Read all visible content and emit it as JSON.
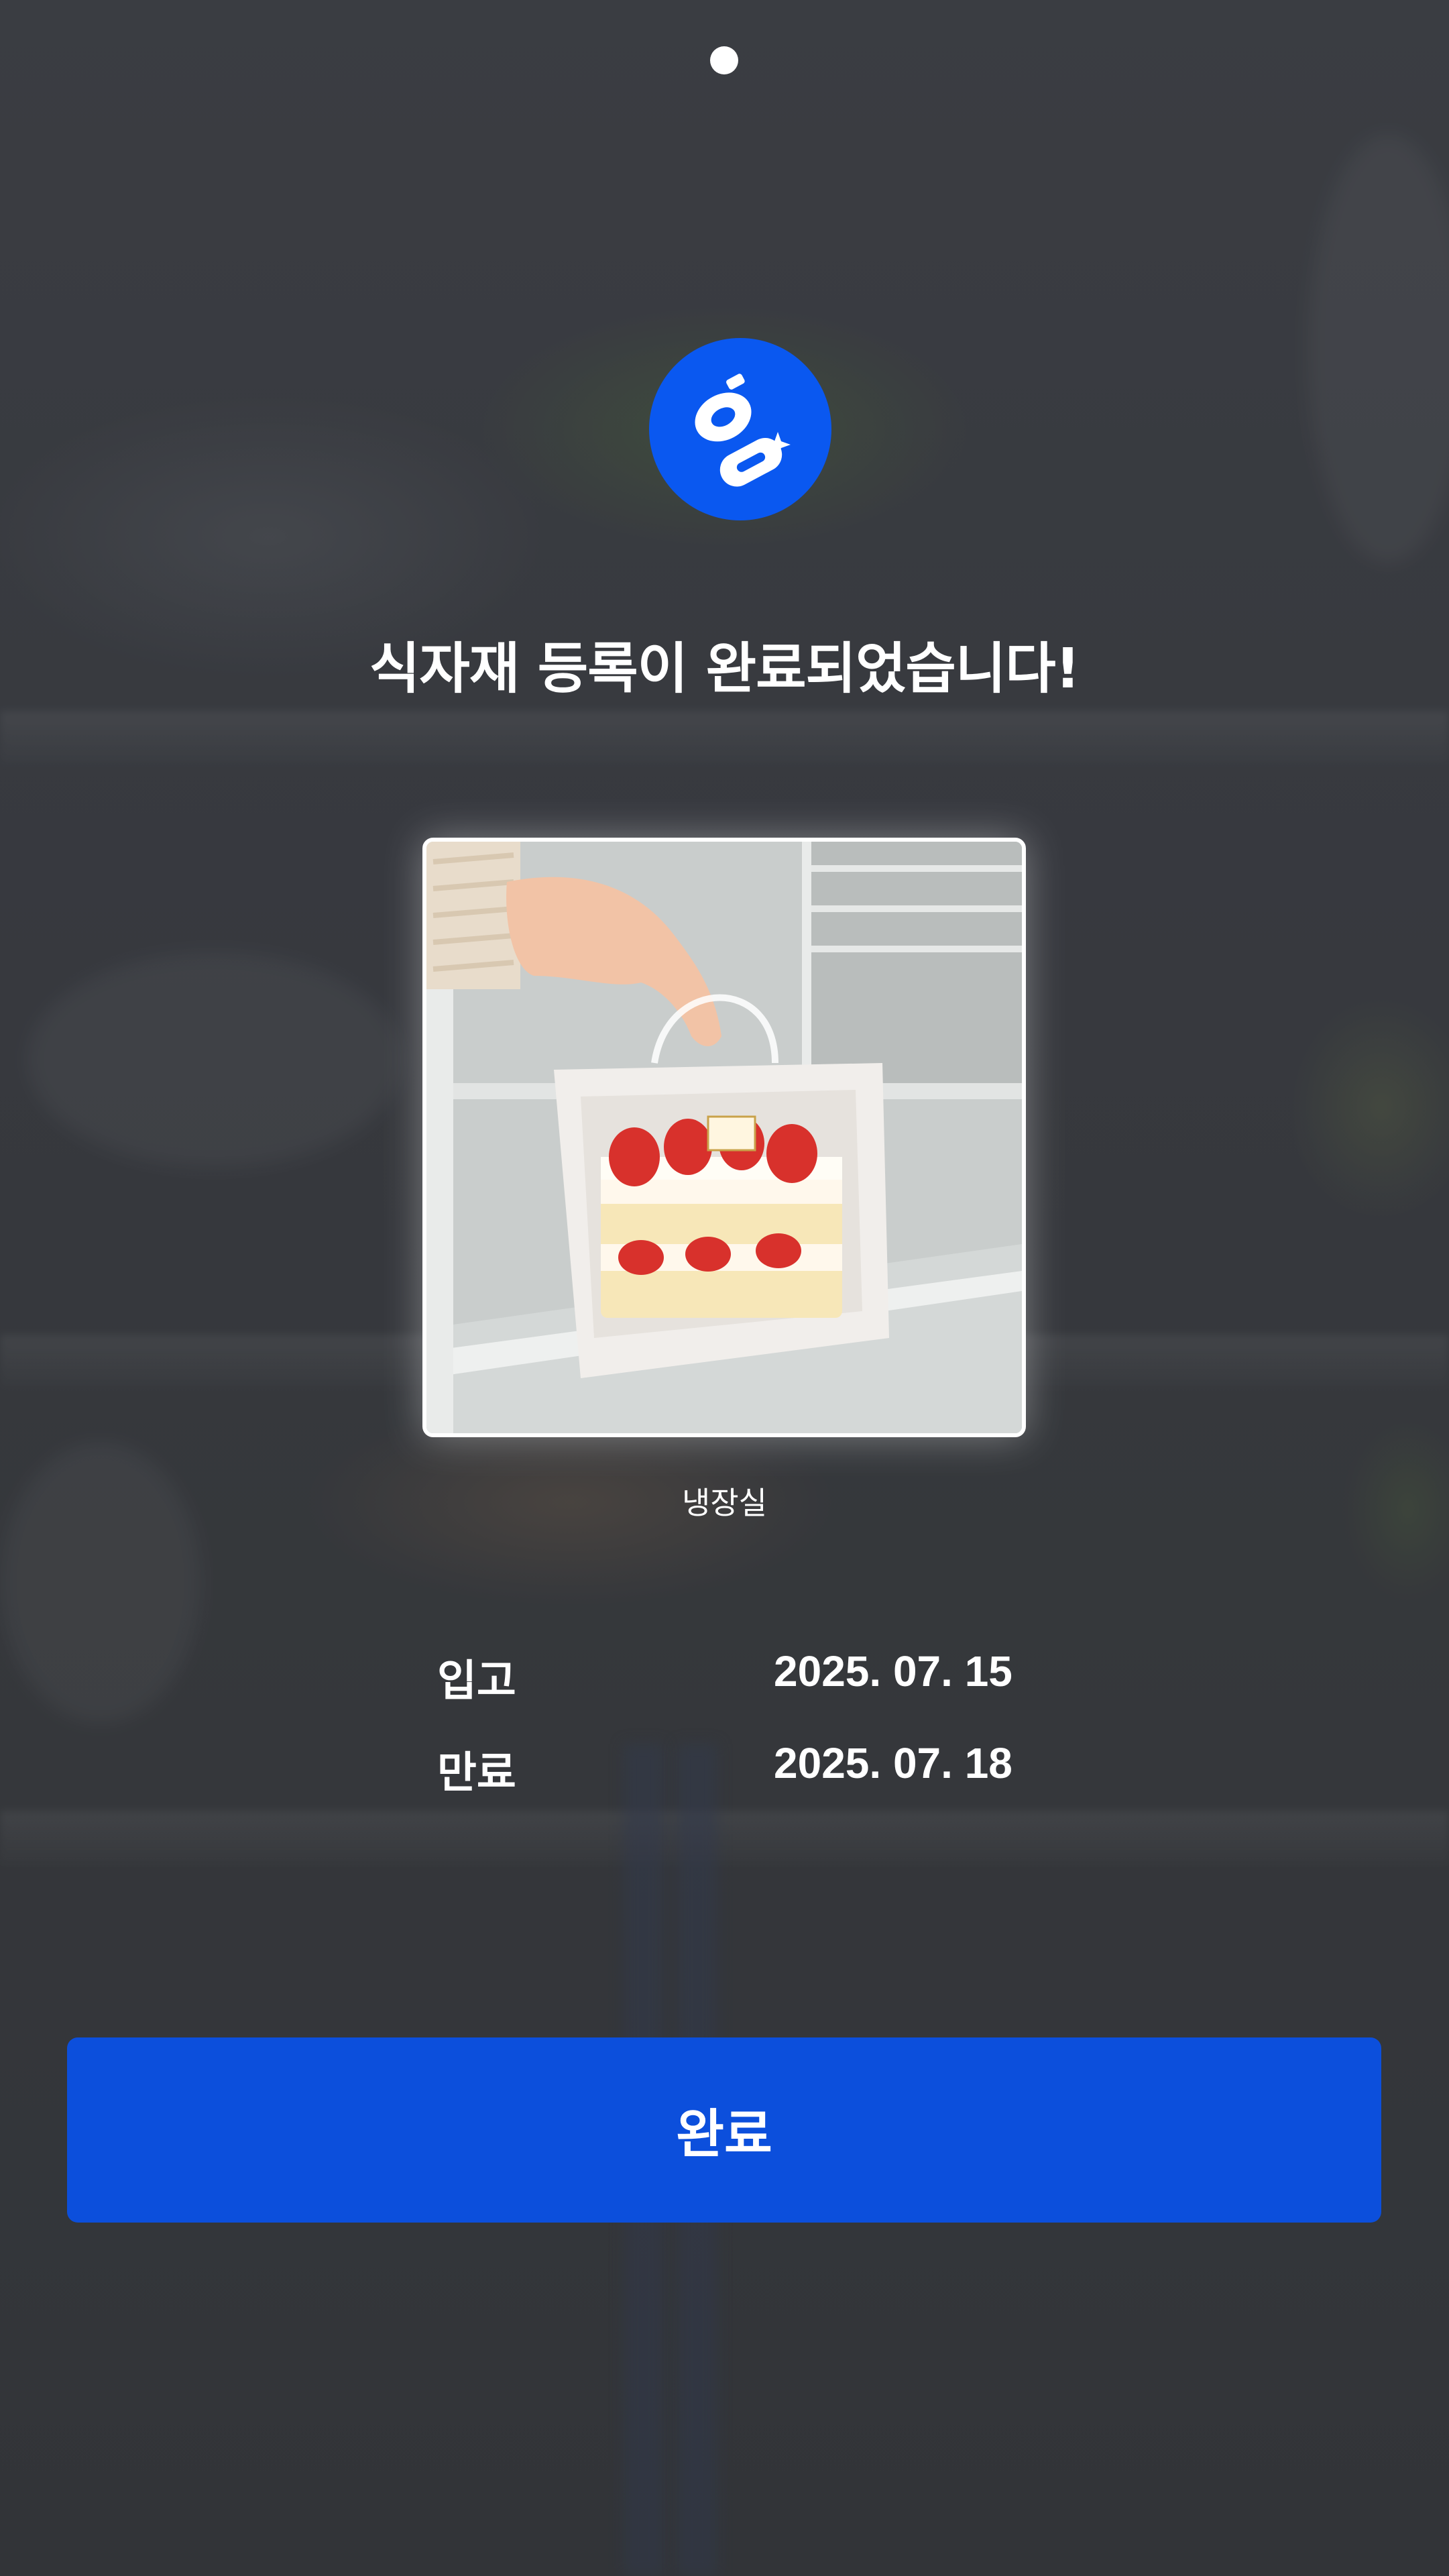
{
  "header": {
    "page_indicator_count": 1,
    "logo_icon": "app-logo-icon"
  },
  "main": {
    "title": "식자재 등록이 완료되었습니다!",
    "photo": {
      "icon": "food-photo-cake",
      "location": "냉장실"
    },
    "dates": [
      {
        "label": "입고",
        "value": "2025. 07. 15"
      },
      {
        "label": "만료",
        "value": "2025. 07. 18"
      }
    ]
  },
  "footer": {
    "done_label": "완료"
  },
  "colors": {
    "accent": "#0a58f0",
    "button": "#0c4fdc",
    "text": "#ffffff"
  }
}
